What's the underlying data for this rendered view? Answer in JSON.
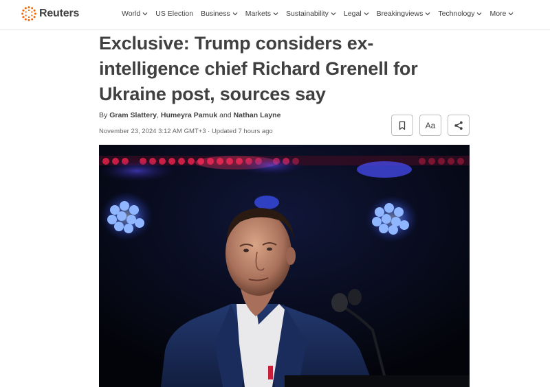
{
  "brand": {
    "name": "Reuters"
  },
  "nav": {
    "items": [
      {
        "label": "World",
        "has_dropdown": true
      },
      {
        "label": "US Election",
        "has_dropdown": false
      },
      {
        "label": "Business",
        "has_dropdown": true
      },
      {
        "label": "Markets",
        "has_dropdown": true
      },
      {
        "label": "Sustainability",
        "has_dropdown": true
      },
      {
        "label": "Legal",
        "has_dropdown": true
      },
      {
        "label": "Breakingviews",
        "has_dropdown": true
      },
      {
        "label": "Technology",
        "has_dropdown": true
      },
      {
        "label": "More",
        "has_dropdown": true
      }
    ]
  },
  "article": {
    "headline": "Exclusive: Trump considers ex-intelligence chief Richard Grenell for Ukraine post, sources say",
    "byline_prefix": "By",
    "authors": [
      "Gram Slattery",
      "Humeyra Pamuk",
      "Nathan Layne"
    ],
    "separator_comma": ",",
    "separator_and": "and",
    "dateline": "November 23, 2024 3:12 AM GMT+3 · Updated 7 hours ago",
    "tools": {
      "bookmark_icon": "bookmark-icon",
      "text_size_label": "Aa",
      "share_icon": "share-icon"
    },
    "image": {
      "alt_subject": "man in dark suit at podium microphone on stage"
    }
  },
  "colors": {
    "text": "#404040",
    "logo_orange": "#fa6400",
    "divider": "#e2e2e2",
    "button_border": "#bdbdbd"
  }
}
